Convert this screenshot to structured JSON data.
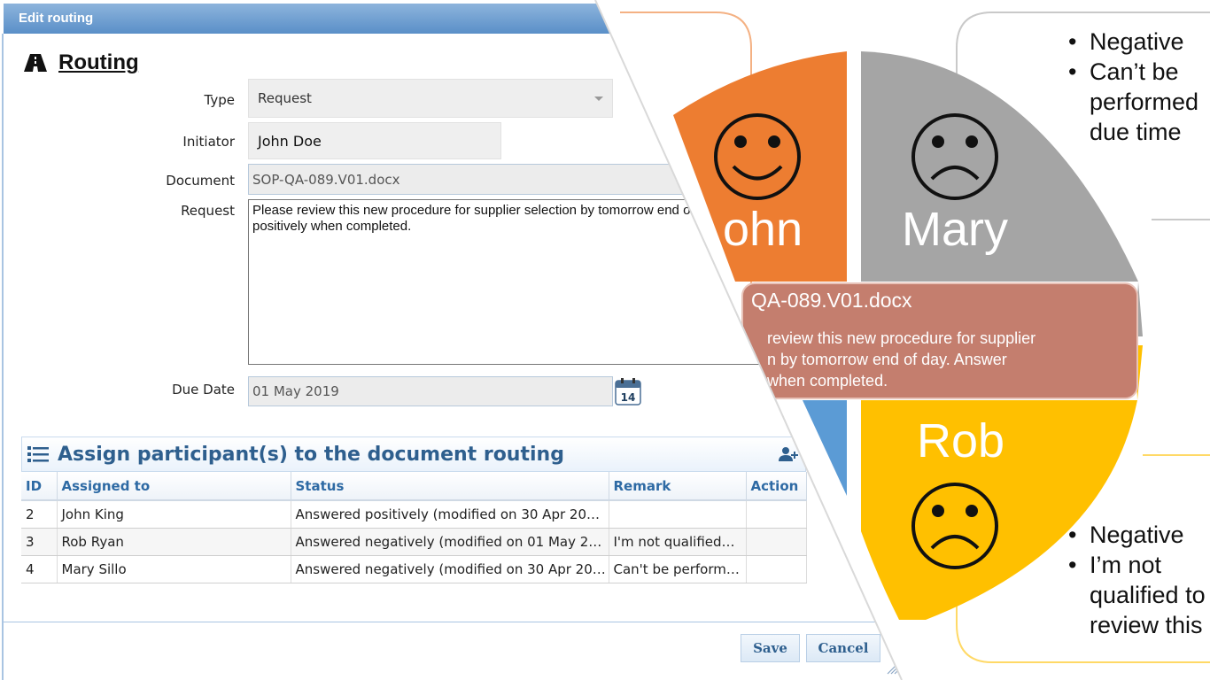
{
  "dialog": {
    "title": "Edit routing",
    "section_title": "Routing",
    "form": {
      "type_label": "Type",
      "type_value": "Request",
      "initiator_label": "Initiator",
      "initiator_value": "John Doe",
      "document_label": "Document",
      "document_value": "SOP-QA-089.V01.docx",
      "request_label": "Request",
      "request_value": "Please review this new procedure for supplier selection by tomorrow end of day. Answer positively when completed.",
      "due_date_label": "Due Date",
      "due_date_value": "01 May 2019",
      "calendar_day": "14"
    },
    "participants": {
      "title": "Assign participant(s) to the document routing",
      "columns": [
        "ID",
        "Assigned to",
        "Status",
        "Remark",
        "Action"
      ],
      "rows": [
        {
          "id": "2",
          "assigned_to": "John King",
          "status": "Answered positively (modified on 30 Apr 20…",
          "remark": "",
          "action": ""
        },
        {
          "id": "3",
          "assigned_to": "Rob Ryan",
          "status": "Answered negatively (modified on 01 May 20…",
          "remark": "I'm not qualified…",
          "action": ""
        },
        {
          "id": "4",
          "assigned_to": "Mary Sillo",
          "status": "Answered negatively (modified on 30 Apr 20…",
          "remark": "Can't be perform…",
          "action": ""
        }
      ]
    },
    "buttons": {
      "save": "Save",
      "cancel": "Cancel"
    }
  },
  "diagram": {
    "colors": {
      "john": "#ed7d31",
      "mary": "#a5a5a5",
      "rob": "#ffc000",
      "fourth": "#5b9bd5",
      "banner": "#c47e6e"
    },
    "quadrants": {
      "john": {
        "name": "John",
        "visible_name": "ohn",
        "face": "smile"
      },
      "mary": {
        "name": "Mary",
        "face": "frown"
      },
      "rob": {
        "name": "Rob",
        "face": "frown"
      }
    },
    "banner": {
      "title": "QA-089.V01.docx",
      "text_line1": "review this new procedure for supplier",
      "text_line2": "n by tomorrow end of day. Answer",
      "text_line3": "when completed."
    },
    "mary_bubble": [
      "Negative",
      "Can’t be",
      "performed",
      "due time"
    ],
    "rob_bubble": [
      "Negative",
      "I’m not",
      "qualified to",
      "review this"
    ]
  }
}
